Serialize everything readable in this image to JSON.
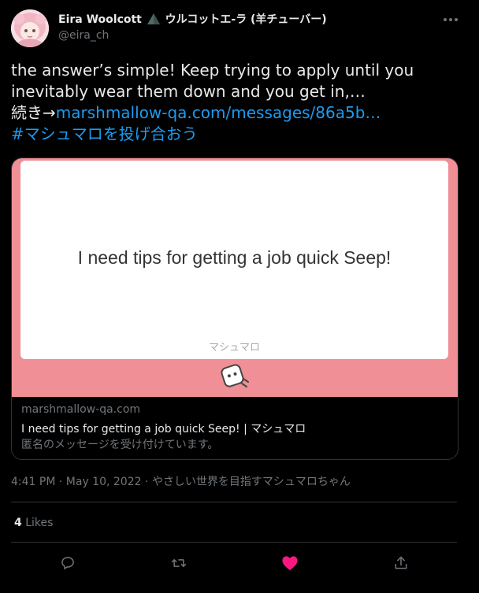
{
  "author": {
    "display_name": "Eira Woolcott",
    "name_suffix": "ウルコットエ-ラ (羊チューバー)",
    "handle": "@eira_ch"
  },
  "tweet": {
    "text_plain": "the answer’s simple! Keep trying to apply until you inevitably wear them down and you get in,…\n続き→",
    "link_text": "marshmallow-qa.com/messages/86a5b…",
    "hashtag": "#マシュマロを投げ合おう"
  },
  "card": {
    "question": "I need tips for getting a job quick Seep!",
    "brand": "マシュマロ",
    "domain": "marshmallow-qa.com",
    "title": "I need tips for getting a job quick Seep! | マシュマロ",
    "description": "匿名のメッセージを受け付けています。"
  },
  "meta": {
    "time": "4:41 PM",
    "date": "May 10, 2022",
    "source": "やさしい世界を目指すマシュマロちゃん"
  },
  "stats": {
    "likes_count": "4",
    "likes_label": "Likes"
  },
  "colors": {
    "link": "#1d9bf0",
    "card_pink": "#f08f95",
    "like_active": "#f91880",
    "muted": "#71767b"
  },
  "icons": {
    "reply": "reply-icon",
    "retweet": "retweet-icon",
    "like": "heart-filled-icon",
    "share": "share-icon",
    "more": "more-icon"
  }
}
